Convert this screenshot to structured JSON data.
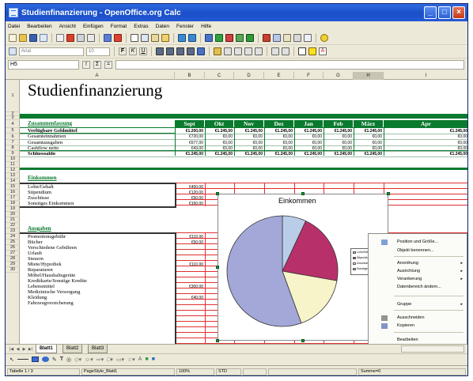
{
  "window": {
    "title": "Studienfinanzierung - OpenOffice.org Calc"
  },
  "menu": [
    "Datei",
    "Bearbeiten",
    "Ansicht",
    "Einfügen",
    "Format",
    "Extras",
    "Daten",
    "Fenster",
    "Hilfe"
  ],
  "toolbar": {
    "font_name": "Arial",
    "font_size": "10"
  },
  "formula_bar": {
    "cell_ref": "H5",
    "value": ""
  },
  "columns": [
    "A",
    "B",
    "C",
    "D",
    "E",
    "F",
    "G",
    "H",
    "I"
  ],
  "rows": [
    "1",
    "2",
    "3",
    "4",
    "5",
    "6",
    "7",
    "8",
    "9",
    "10",
    "11",
    "12",
    "13",
    "14",
    "15",
    "16",
    "17",
    "18",
    "19",
    "20",
    "21",
    "22",
    "23",
    "24",
    "25",
    "26",
    "27",
    "28",
    "29",
    "30"
  ],
  "sheet": {
    "title": "Studienfinanzierung",
    "months": [
      "Sept",
      "Okt",
      "Nov",
      "Dez",
      "Jan",
      "Feb",
      "März",
      "Apr"
    ],
    "summary_header": "Zusammenfassung",
    "summary_rows": [
      {
        "label": "Verfügbare Geldmittel",
        "values": [
          "€1.200,00",
          "€1.245,00",
          "€1.245,00",
          "€1.245,00",
          "€1.245,00",
          "€1.245,00",
          "€1.245,00",
          "€1.245,00"
        ]
      },
      {
        "label": "Gesamteinnahmen",
        "values": [
          "€720,00",
          "€0,00",
          "€0,00",
          "€0,00",
          "€0,00",
          "€0,00",
          "€0,00",
          "€0,00"
        ]
      },
      {
        "label": "Gesamtausgaben",
        "values": [
          "€677,00",
          "€0,00",
          "€0,00",
          "€0,00",
          "€0,00",
          "€0,00",
          "€0,00",
          "€0,00"
        ]
      },
      {
        "label": "Cashflow netto",
        "values": [
          "€43,00",
          "€0,00",
          "€0,00",
          "€0,00",
          "€0,00",
          "€0,00",
          "€0,00",
          "€0,00"
        ]
      },
      {
        "label": "Schlusssaldo",
        "values": [
          "€1.245,00",
          "€1.245,00",
          "€1.245,00",
          "€1.245,00",
          "€1.245,00",
          "€1.245,00",
          "€1.245,00",
          "€1.245,00"
        ]
      }
    ],
    "income_header": "Einkommen",
    "income_rows": [
      {
        "label": "Lohn/Gehalt",
        "value": "€400,00"
      },
      {
        "label": "Stipendium",
        "value": "€120,00"
      },
      {
        "label": "Zuschüsse",
        "value": "€50,00"
      },
      {
        "label": "Sonstiges Einkommen",
        "value": "€150,00"
      }
    ],
    "expense_header": "Ausgaben",
    "expense_rows": [
      {
        "label": "Promotionsgebühr",
        "value": "€110,00"
      },
      {
        "label": "Bücher",
        "value": "€50,00"
      },
      {
        "label": "Verschiedene Gebühren",
        "value": ""
      },
      {
        "label": "Urlaub",
        "value": ""
      },
      {
        "label": "Steuern",
        "value": ""
      },
      {
        "label": "Miete/Hypothek",
        "value": "€110,00"
      },
      {
        "label": "Reparaturen",
        "value": ""
      },
      {
        "label": "Möbel/Haushaltsgeräte",
        "value": ""
      },
      {
        "label": "Kreditkarte/Sonstige Kredite",
        "value": ""
      },
      {
        "label": "Lebensmittel",
        "value": "€300,00"
      },
      {
        "label": "Medizinische Versorgung",
        "value": ""
      },
      {
        "label": "Kleidung",
        "value": "€40,00"
      },
      {
        "label": "Fahrzeugversicherung",
        "value": ""
      }
    ]
  },
  "chart": {
    "title": "Einkommen",
    "legend": [
      "Lohn/Gehalt",
      "Stipendium",
      "Zuschüsse",
      "Sonstiges Einkommen"
    ],
    "colors": [
      "#b9cde8",
      "#b8306a",
      "#f6f4c8",
      "#a3a8d8"
    ]
  },
  "chart_data": {
    "type": "pie",
    "title": "Einkommen",
    "categories": [
      "Lohn/Gehalt",
      "Stipendium",
      "Zuschüsse",
      "Sonstiges Einkommen"
    ],
    "values": [
      50,
      150,
      120,
      400
    ]
  },
  "context_menu": {
    "items": [
      {
        "label": "Position und Größe...",
        "submenu": false
      },
      {
        "label": "Objekt benennen...",
        "submenu": false
      },
      {
        "label": "Anordnung",
        "submenu": true
      },
      {
        "label": "Ausrichtung",
        "submenu": true
      },
      {
        "label": "Verankerung",
        "submenu": true
      },
      {
        "label": "Datenbereich ändern...",
        "submenu": false
      },
      {
        "label": "Gruppe",
        "submenu": true
      },
      {
        "label": "Ausschneiden",
        "submenu": false
      },
      {
        "label": "Kopieren",
        "submenu": false
      },
      {
        "label": "Bearbeiten",
        "submenu": false
      }
    ]
  },
  "tabs": [
    "Blatt1",
    "Blatt2",
    "Blatt3"
  ],
  "status": {
    "sheet": "Tabelle 1 / 3",
    "style": "PageStyle_Blatt1",
    "zoom": "100%",
    "mode": "STD",
    "sum": "Summe=0"
  },
  "colors": {
    "accent_green": "#0a7a2e",
    "border_red": "#e03030",
    "titlebar_blue": "#1a4fc8"
  }
}
